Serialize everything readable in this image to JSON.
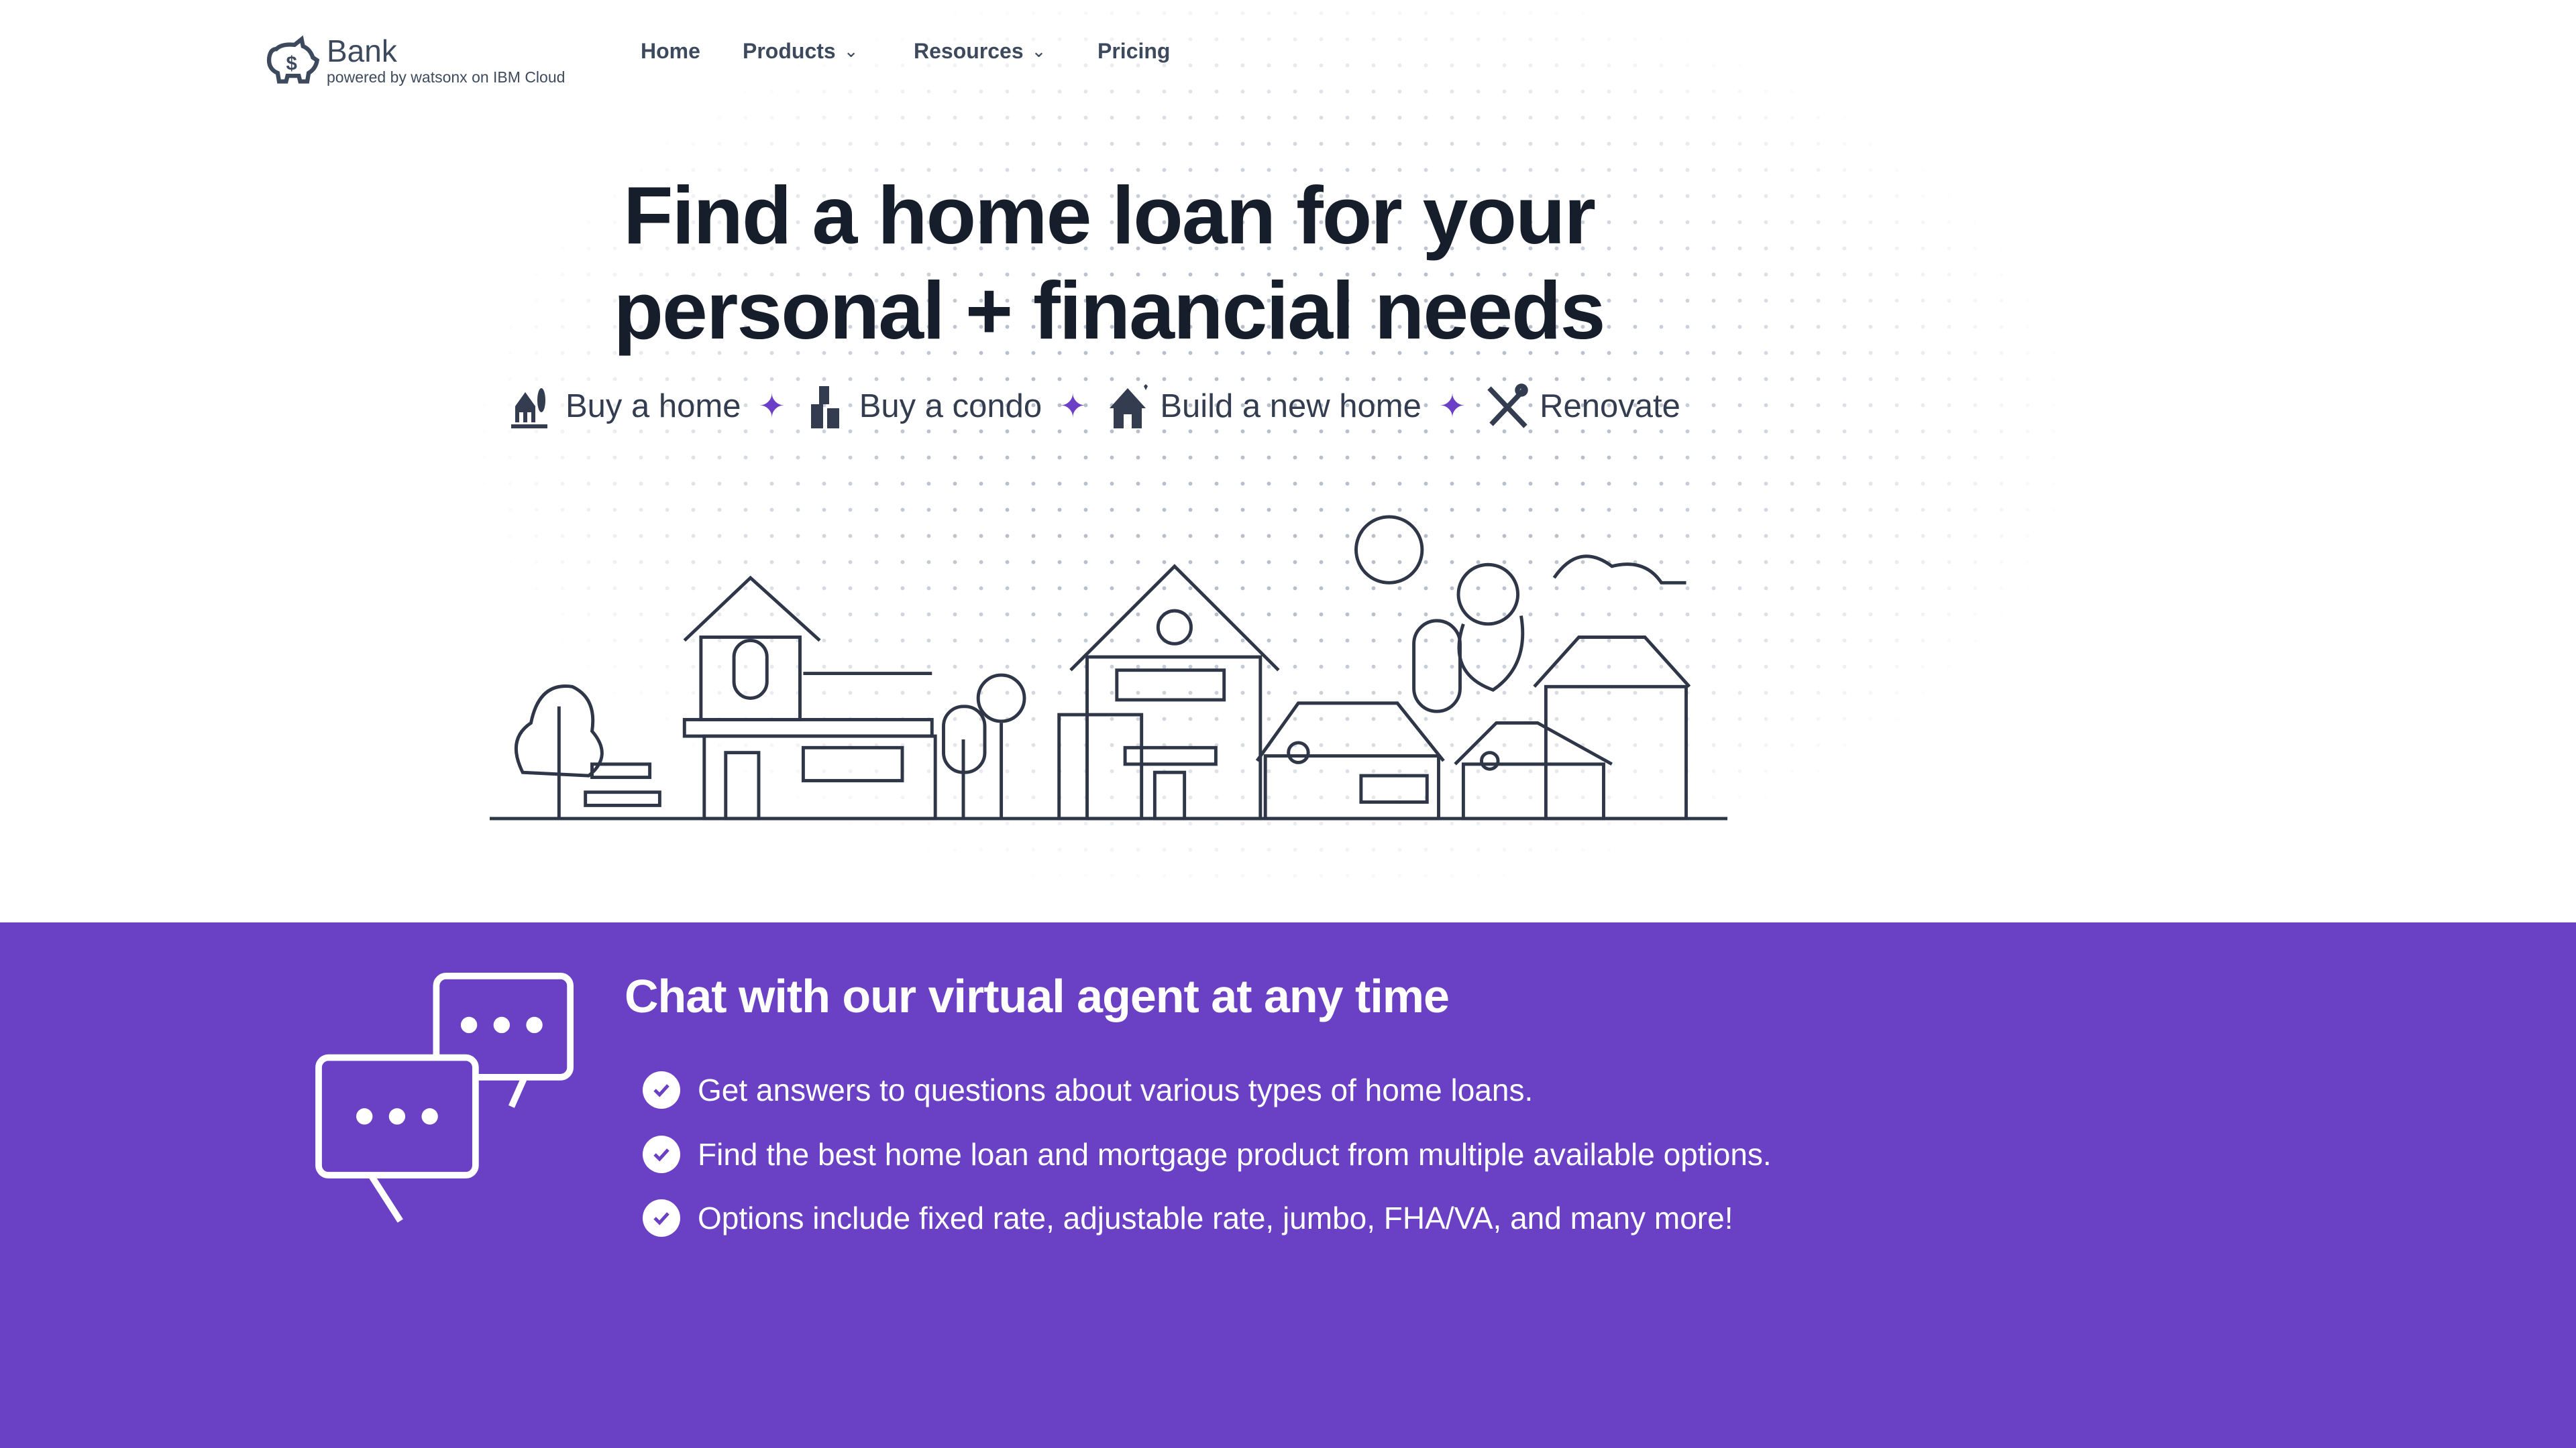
{
  "header": {
    "brand": "Bank",
    "tagline": "powered by watsonx on IBM Cloud",
    "nav": [
      {
        "label": "Home"
      },
      {
        "label": "Products",
        "dropdown": true
      },
      {
        "label": "Resources",
        "dropdown": true
      },
      {
        "label": "Pricing"
      }
    ]
  },
  "hero": {
    "title_line1": "Find a home loan for your",
    "title_line2": "personal + financial needs",
    "options": [
      {
        "label": "Buy a home",
        "icon": "house-tree-icon"
      },
      {
        "label": "Buy a condo",
        "icon": "building-icon"
      },
      {
        "label": "Build a new home",
        "icon": "new-house-icon"
      },
      {
        "label": "Renovate",
        "icon": "tools-icon"
      }
    ],
    "separator": "✦"
  },
  "chat": {
    "heading": "Chat with our virtual agent at any time",
    "bullets": [
      "Get answers to questions about various types of home loans.",
      "Find the best home loan and mortgage product from multiple available options.",
      "Options include fixed rate, adjustable rate, jumbo, FHA/VA, and many more!"
    ]
  },
  "colors": {
    "accent": "#6a40c4",
    "text": "#161d2b"
  }
}
